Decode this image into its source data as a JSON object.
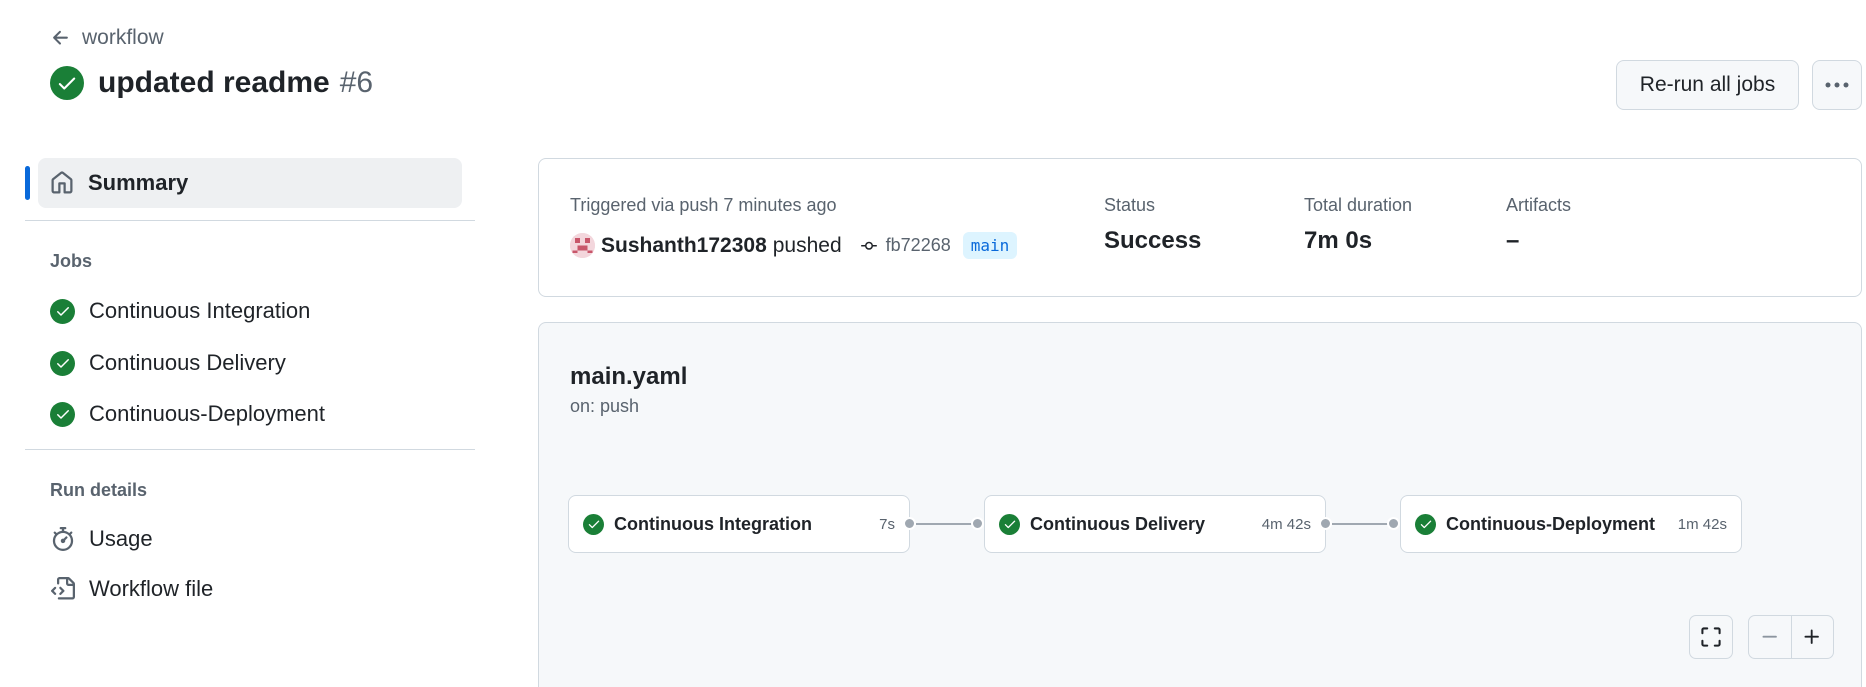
{
  "header": {
    "back_label": "workflow",
    "run_title": "updated readme",
    "run_number": "#6",
    "rerun_label": "Re-run all jobs"
  },
  "sidebar": {
    "summary_label": "Summary",
    "jobs_heading": "Jobs",
    "jobs": [
      {
        "label": "Continuous Integration",
        "status": "success"
      },
      {
        "label": "Continuous Delivery",
        "status": "success"
      },
      {
        "label": "Continuous-Deployment",
        "status": "success"
      }
    ],
    "run_details_heading": "Run details",
    "details": [
      {
        "label": "Usage",
        "icon": "stopwatch-icon"
      },
      {
        "label": "Workflow file",
        "icon": "file-code-icon"
      }
    ]
  },
  "trigger": {
    "triggered_text": "Triggered via push 7 minutes ago",
    "username": "Sushanth172308",
    "action": "pushed",
    "commit_sha": "fb72268",
    "branch": "main",
    "status_label": "Status",
    "status_value": "Success",
    "duration_label": "Total duration",
    "duration_value": "7m 0s",
    "artifacts_label": "Artifacts",
    "artifacts_value": "–"
  },
  "graph": {
    "workflow_file": "main.yaml",
    "trigger": "on: push",
    "jobs": [
      {
        "name": "Continuous Integration",
        "duration": "7s"
      },
      {
        "name": "Continuous Delivery",
        "duration": "4m 42s"
      },
      {
        "name": "Continuous-Deployment",
        "duration": "1m 42s"
      }
    ]
  },
  "colors": {
    "success": "#1a7f37",
    "accent": "#0969da",
    "muted": "#59636e"
  }
}
